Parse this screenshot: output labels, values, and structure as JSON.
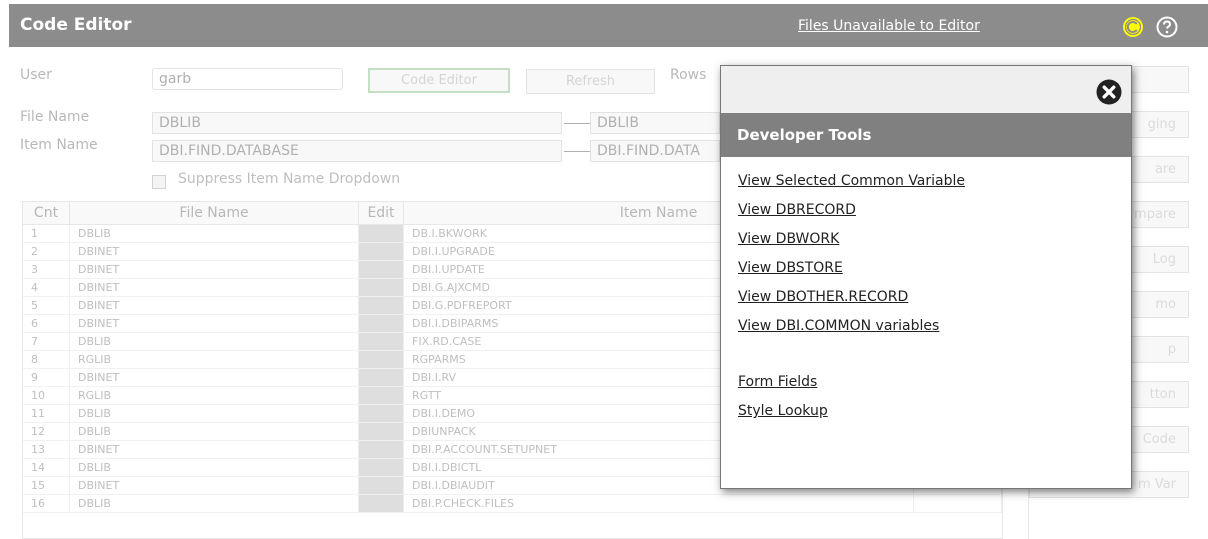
{
  "header": {
    "title": "Code Editor",
    "files_link": "Files Unavailable to Editor",
    "icons": {
      "c_icon": "c-circle-icon",
      "help_icon": "help-icon"
    },
    "c_icon_color": "#ffff00",
    "bar_color": "#8c8c8c"
  },
  "form": {
    "user_label": "User",
    "user_value": "garb",
    "code_editor_button": "Code Editor",
    "refresh_button": "Refresh",
    "rows_label": "Rows",
    "file_label": "File Name",
    "file_value": "DBLIB",
    "file_value_2": "DBLIB",
    "item_label": "Item Name",
    "item_value": "DBI.FIND.DATABASE",
    "item_value_2": "DBI.FIND.DATA",
    "suppress_label": "Suppress Item Name Dropdown"
  },
  "grid": {
    "headers": {
      "cnt": "Cnt",
      "file": "File Name",
      "edit": "Edit",
      "item": "Item Name"
    },
    "rows": [
      {
        "cnt": "1",
        "file": "DBLIB",
        "item": "DB.I.BKWORK"
      },
      {
        "cnt": "2",
        "file": "DBINET",
        "item": "DBI.I.UPGRADE"
      },
      {
        "cnt": "3",
        "file": "DBINET",
        "item": "DBI.I.UPDATE"
      },
      {
        "cnt": "4",
        "file": "DBINET",
        "item": "DBI.G.AJXCMD"
      },
      {
        "cnt": "5",
        "file": "DBINET",
        "item": "DBI.G.PDFREPORT"
      },
      {
        "cnt": "6",
        "file": "DBINET",
        "item": "DBI.I.DBIPARMS"
      },
      {
        "cnt": "7",
        "file": "DBLIB",
        "item": "FIX.RD.CASE"
      },
      {
        "cnt": "8",
        "file": "RGLIB",
        "item": "RGPARMS"
      },
      {
        "cnt": "9",
        "file": "DBINET",
        "item": "DBI.I.RV"
      },
      {
        "cnt": "10",
        "file": "RGLIB",
        "item": "RGTT"
      },
      {
        "cnt": "11",
        "file": "DBLIB",
        "item": "DBI.I.DEMO"
      },
      {
        "cnt": "12",
        "file": "DBLIB",
        "item": "DBIUNPACK"
      },
      {
        "cnt": "13",
        "file": "DBINET",
        "item": "DBI.P.ACCOUNT.SETUPNET"
      },
      {
        "cnt": "14",
        "file": "DBLIB",
        "item": "DBI.I.DBICTL"
      },
      {
        "cnt": "15",
        "file": "DBINET",
        "item": "DBI.I.DBIAUDIT"
      },
      {
        "cnt": "16",
        "file": "DBLIB",
        "item": "DBI.P.CHECK.FILES"
      }
    ]
  },
  "side_buttons": [
    "",
    "ging",
    "are",
    "mpare",
    "Log",
    "mo",
    "p",
    "tton",
    "Code",
    "m Var"
  ],
  "modal": {
    "title": "Developer Tools",
    "close_icon": "close-circle-icon",
    "links": [
      "View Selected Common Variable",
      "View DBRECORD",
      "View DBWORK",
      "View DBSTORE",
      "View DBOTHER.RECORD",
      "View DBI.COMMON variables"
    ],
    "links2": [
      "Form Fields",
      "Style Lookup"
    ]
  }
}
